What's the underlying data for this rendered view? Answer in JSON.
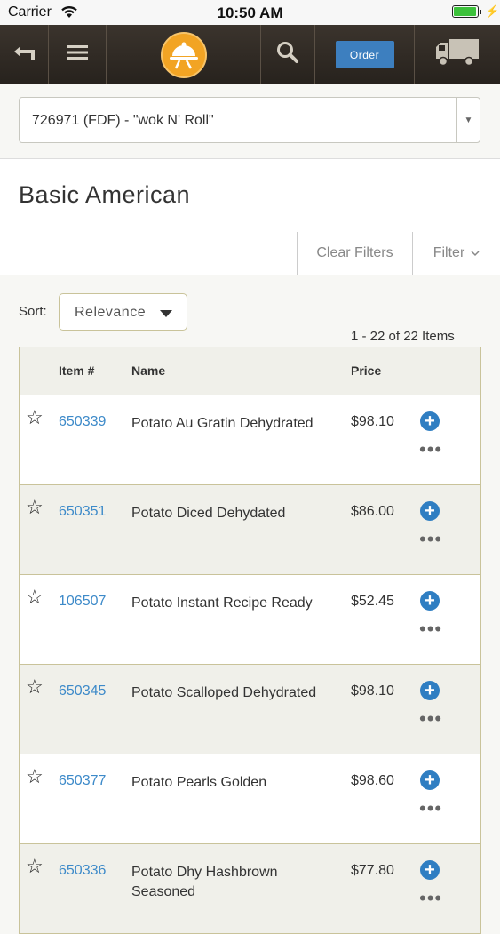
{
  "status_bar": {
    "carrier": "Carrier",
    "time": "10:50 AM",
    "battery_level": 1.0
  },
  "nav": {
    "back_icon": "back-arrow-icon",
    "menu_icon": "hamburger-menu-icon",
    "logo_icon": "server-cloche-logo-icon",
    "search_icon": "search-icon",
    "order_label": "Order",
    "truck_icon": "delivery-truck-icon"
  },
  "account": {
    "selected": "726971 (FDF) - \"wok N' Roll\""
  },
  "page": {
    "title": "Basic American"
  },
  "filters": {
    "clear_label": "Clear Filters",
    "filter_label": "Filter"
  },
  "sort": {
    "label": "Sort:",
    "selected": "Relevance"
  },
  "results": {
    "count_text": "1 - 22 of 22 Items"
  },
  "table": {
    "headers": {
      "item": "Item #",
      "name": "Name",
      "price": "Price"
    },
    "rows": [
      {
        "item": "650339",
        "name": "Potato Au Gratin Dehydrated",
        "price": "$98.10"
      },
      {
        "item": "650351",
        "name": "Potato Diced Dehydated",
        "price": "$86.00"
      },
      {
        "item": "106507",
        "name": "Potato Instant Recipe Ready",
        "price": "$52.45"
      },
      {
        "item": "650345",
        "name": "Potato Scalloped Dehydrated",
        "price": "$98.10"
      },
      {
        "item": "650377",
        "name": "Potato Pearls Golden",
        "price": "$98.60"
      },
      {
        "item": "650336",
        "name": "Potato Dhy Hashbrown Seasoned",
        "price": "$77.80"
      }
    ]
  },
  "colors": {
    "link": "#3d8ac9",
    "accent": "#2f7ec2",
    "nav_bg": "#2f2924"
  }
}
